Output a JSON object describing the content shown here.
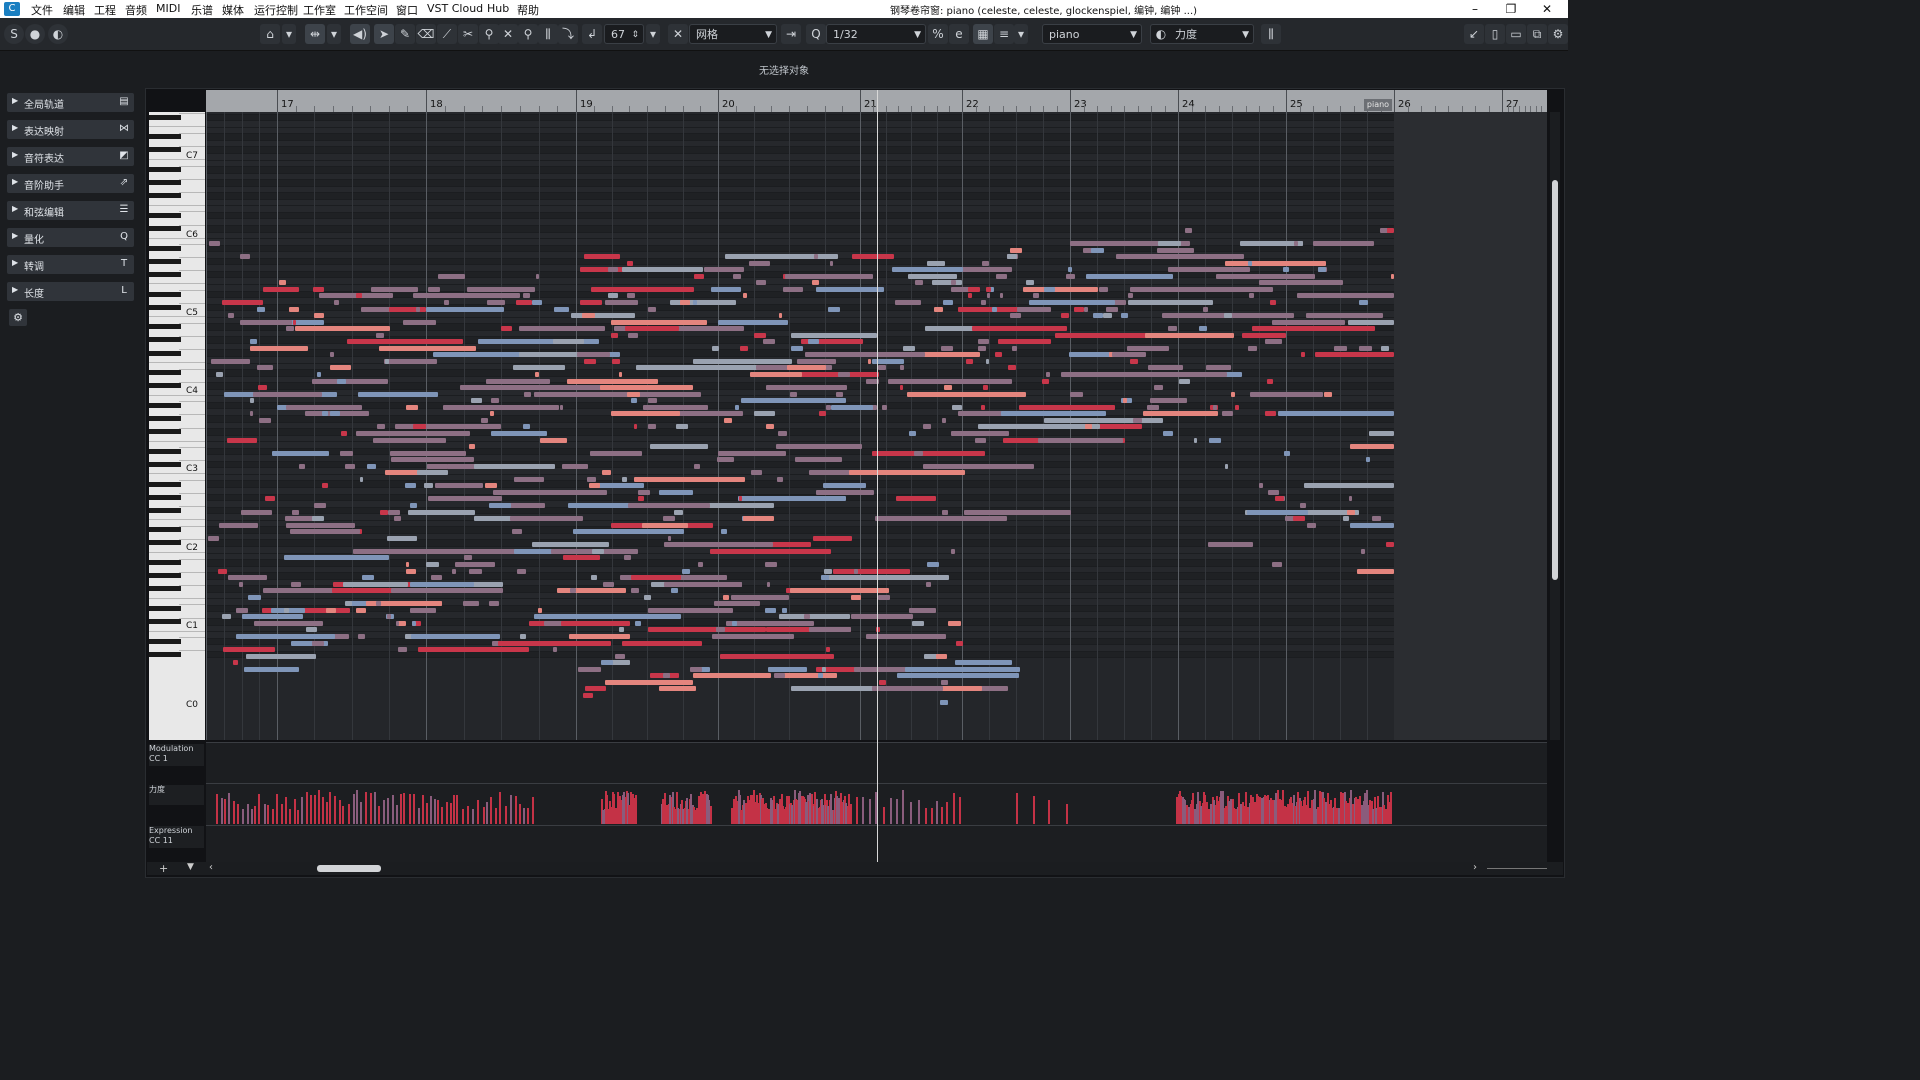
{
  "menubar": {
    "items": [
      "文件",
      "编辑",
      "工程",
      "音频",
      "MIDI",
      "乐谱",
      "媒体",
      "运行控制",
      "工作室",
      "工作空间",
      "窗口",
      "VST Cloud",
      "Hub",
      "帮助"
    ],
    "window_title": "钢琴卷帘窗: piano (celeste, celeste, glockenspiel, 编钟, 编钟 ...)",
    "window_buttons": [
      "–",
      "❐",
      "✕"
    ]
  },
  "toolbar": {
    "velocity_value": "67",
    "snap_type": "网格",
    "quantize": "1/32",
    "track_name": "piano",
    "controller": "力度"
  },
  "info": {
    "message": "无选择对象"
  },
  "inspector": {
    "sections": [
      {
        "label": "全局轨道",
        "icon": "▤"
      },
      {
        "label": "表达映射",
        "icon": "⋈"
      },
      {
        "label": "音符表达",
        "icon": "◩"
      },
      {
        "label": "音阶助手",
        "icon": "⇗"
      },
      {
        "label": "和弦编辑",
        "icon": "☰"
      },
      {
        "label": "量化",
        "icon": "Q"
      },
      {
        "label": "转调",
        "icon": "T"
      },
      {
        "label": "长度",
        "icon": "L"
      }
    ]
  },
  "ruler": {
    "bars": [
      "17",
      "18",
      "19",
      "20",
      "21",
      "22",
      "23",
      "24",
      "25",
      "26",
      "27"
    ],
    "part_label": "piano"
  },
  "keyboard": {
    "octaves": [
      "C7",
      "C6",
      "C5",
      "C4",
      "C3",
      "C2",
      "C1",
      "C0"
    ]
  },
  "controller_lanes": [
    {
      "line1": "Modulation",
      "line2": "CC 1"
    },
    {
      "line1": "力度",
      "line2": ""
    },
    {
      "line1": "Expression",
      "line2": "CC 11"
    }
  ],
  "colors": {
    "note_blue": "#7f95b8",
    "note_mauve": "#8d6f84",
    "note_red": "#c8364a",
    "note_salmon": "#e4857e",
    "note_gray": "#9aa2b0"
  }
}
